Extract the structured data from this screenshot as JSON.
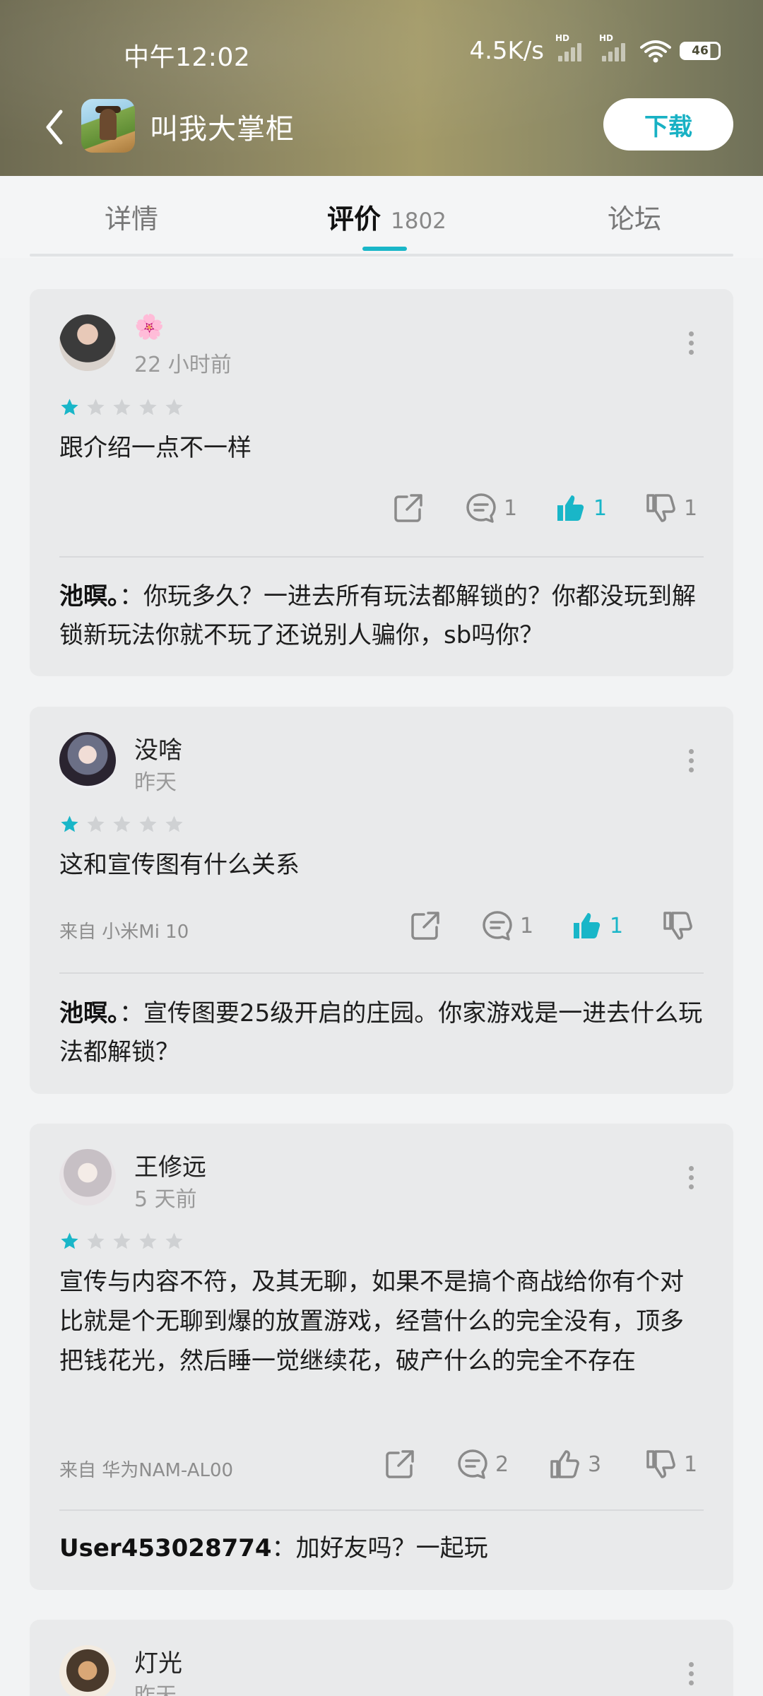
{
  "status_bar": {
    "time": "中午12:02",
    "network_speed": "4.5K/s",
    "signal1_label": "HD",
    "signal2_label": "HD",
    "battery": "46"
  },
  "app_bar": {
    "title": "叫我大掌柜",
    "download_label": "下载"
  },
  "tabs": [
    {
      "label": "详情"
    },
    {
      "label": "评价",
      "count": "1802",
      "active": true
    },
    {
      "label": "论坛"
    }
  ],
  "reviews": [
    {
      "username": "",
      "badge": "🌸",
      "time": "22 小时前",
      "stars": 1,
      "text": "跟介绍一点不一样",
      "device": "",
      "comments": "1",
      "likes": "1",
      "liked": true,
      "dislikes": "1",
      "reply_author": "池暝。",
      "reply_text": "：你玩多久？一进去所有玩法都解锁的？你都没玩到解锁新玩法你就不玩了还说别人骗你，sb吗你？"
    },
    {
      "username": "没啥",
      "time": "昨天",
      "stars": 1,
      "text": "这和宣传图有什么关系",
      "device": "来自  小米Mi 10",
      "comments": "1",
      "likes": "1",
      "liked": true,
      "dislikes": "",
      "reply_author": "池暝。",
      "reply_text": "：宣传图要25级开启的庄园。你家游戏是一进去什么玩法都解锁？"
    },
    {
      "username": "王修远",
      "time": "5 天前",
      "stars": 1,
      "text": "宣传与内容不符，及其无聊，如果不是搞个商战给你有个对比就是个无聊到爆的放置游戏，经营什么的完全没有，顶多把钱花光，然后睡一觉继续花，破产什么的完全不存在",
      "device": "来自  华为NAM-AL00",
      "comments": "2",
      "likes": "3",
      "liked": false,
      "dislikes": "1",
      "reply_author": "User453028774",
      "reply_text": "：加好友吗？一起玩"
    },
    {
      "username": "灯光",
      "time": "昨天"
    }
  ],
  "colors": {
    "accent": "#19b6c8",
    "card_bg": "#e9eaeb",
    "page_bg": "#f2f3f4"
  }
}
